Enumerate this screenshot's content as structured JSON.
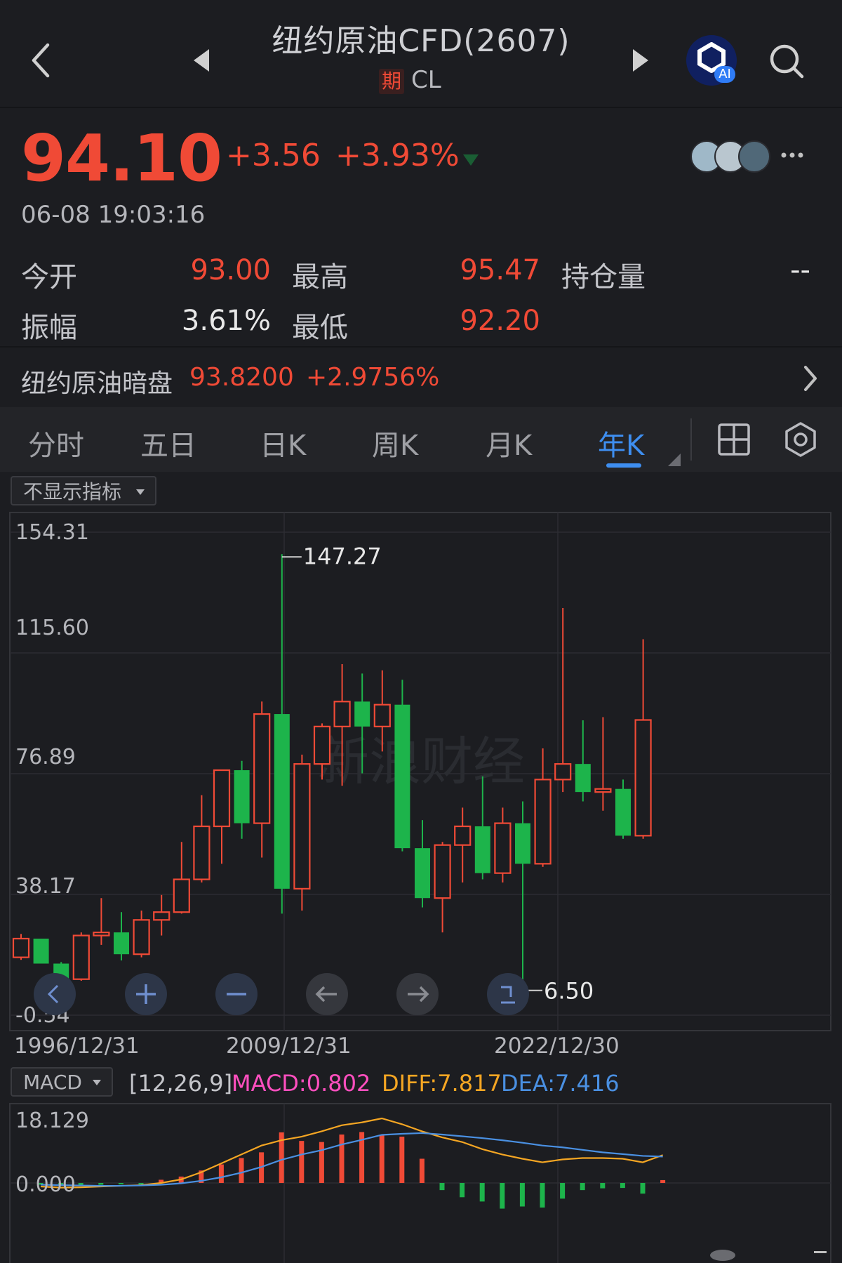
{
  "header": {
    "title": "纽约原油CFD(2607)",
    "badge": "期",
    "code": "CL",
    "ai_badge": "AI"
  },
  "quote": {
    "price": "94.10",
    "change": "+3.56",
    "change_pct": "+3.93%",
    "datetime": "06-08 19:03:16",
    "stats": {
      "open_label": "今开",
      "open": "93.00",
      "high_label": "最高",
      "high": "95.47",
      "oi_label": "持仓量",
      "oi": "--",
      "amp_label": "振幅",
      "amp": "3.61%",
      "low_label": "最低",
      "low": "92.20"
    },
    "dark": {
      "label": "纽约原油暗盘",
      "price": "93.8200",
      "pct": "+2.9756%"
    }
  },
  "tabs": [
    {
      "label": "分时"
    },
    {
      "label": "五日"
    },
    {
      "label": "日K"
    },
    {
      "label": "周K"
    },
    {
      "label": "月K"
    },
    {
      "label": "年K"
    }
  ],
  "indicator": {
    "label": "不显示指标"
  },
  "watermark": "新浪财经",
  "colors": {
    "up": "#f04a36",
    "down": "#1db44b",
    "accent": "#3e8ef0",
    "macd": "#ff4fbf",
    "diff": "#f5a623",
    "dea": "#4a90e2"
  },
  "chart_data": [
    {
      "type": "candlestick",
      "period": "yearly",
      "y_ticks": [
        "154.31",
        "115.60",
        "76.89",
        "38.17",
        "-0.54"
      ],
      "ylim": [
        -0.54,
        154.31
      ],
      "x_labels": [
        "1996/12/31",
        "2009/12/31",
        "2022/12/30"
      ],
      "max_label": "147.27",
      "min_label": "6.50",
      "candles": [
        {
          "o": 18.0,
          "h": 25.5,
          "l": 17.2,
          "c": 24.0
        },
        {
          "o": 24.0,
          "h": 24.0,
          "l": 16.0,
          "c": 16.0
        },
        {
          "o": 16.0,
          "h": 16.5,
          "l": 10.5,
          "c": 11.0
        },
        {
          "o": 11.0,
          "h": 26.0,
          "l": 10.5,
          "c": 25.0
        },
        {
          "o": 25.0,
          "h": 37.0,
          "l": 22.0,
          "c": 26.0
        },
        {
          "o": 26.0,
          "h": 32.5,
          "l": 17.0,
          "c": 19.0
        },
        {
          "o": 19.0,
          "h": 33.0,
          "l": 18.0,
          "c": 30.0
        },
        {
          "o": 30.0,
          "h": 38.0,
          "l": 25.0,
          "c": 32.5
        },
        {
          "o": 32.5,
          "h": 55.0,
          "l": 32.0,
          "c": 43.0
        },
        {
          "o": 43.0,
          "h": 70.0,
          "l": 42.0,
          "c": 60.0
        },
        {
          "o": 60.0,
          "h": 78.0,
          "l": 48.0,
          "c": 78.0
        },
        {
          "o": 78.0,
          "h": 81.0,
          "l": 56.0,
          "c": 61.0
        },
        {
          "o": 61.0,
          "h": 100.0,
          "l": 50.0,
          "c": 96.0
        },
        {
          "o": 96.0,
          "h": 147.27,
          "l": 32.0,
          "c": 40.0
        },
        {
          "o": 40.0,
          "h": 83.0,
          "l": 33.0,
          "c": 80.0
        },
        {
          "o": 80.0,
          "h": 93.0,
          "l": 75.0,
          "c": 92.0
        },
        {
          "o": 92.0,
          "h": 112.0,
          "l": 73.0,
          "c": 100.0
        },
        {
          "o": 100.0,
          "h": 109.0,
          "l": 77.0,
          "c": 92.0
        },
        {
          "o": 92.0,
          "h": 110.0,
          "l": 84.0,
          "c": 99.0
        },
        {
          "o": 99.0,
          "h": 107.0,
          "l": 52.0,
          "c": 53.0
        },
        {
          "o": 53.0,
          "h": 62.0,
          "l": 34.0,
          "c": 37.0
        },
        {
          "o": 37.0,
          "h": 55.0,
          "l": 26.0,
          "c": 54.0
        },
        {
          "o": 54.0,
          "h": 66.0,
          "l": 42.0,
          "c": 60.0
        },
        {
          "o": 60.0,
          "h": 76.0,
          "l": 43.0,
          "c": 45.0
        },
        {
          "o": 45.0,
          "h": 66.0,
          "l": 42.0,
          "c": 61.0
        },
        {
          "o": 61.0,
          "h": 68.0,
          "l": 6.5,
          "c": 48.0
        },
        {
          "o": 48.0,
          "h": 85.0,
          "l": 47.0,
          "c": 75.0
        },
        {
          "o": 75.0,
          "h": 130.0,
          "l": 71.0,
          "c": 80.0
        },
        {
          "o": 80.0,
          "h": 94.0,
          "l": 68.0,
          "c": 71.0
        },
        {
          "o": 71.0,
          "h": 95.0,
          "l": 65.0,
          "c": 72.0
        },
        {
          "o": 72.0,
          "h": 75.0,
          "l": 56.0,
          "c": 57.0
        },
        {
          "o": 57.0,
          "h": 120.0,
          "l": 56.0,
          "c": 94.1
        }
      ]
    },
    {
      "type": "bar",
      "name": "MACD",
      "params": "[12,26,9]",
      "macd_text": "MACD:0.802",
      "diff_text": "DIFF:7.817",
      "dea_text": "DEA:7.416",
      "y_ticks": [
        "18.129",
        "0.000"
      ],
      "ylim": [
        -8.0,
        18.129
      ],
      "series": [
        {
          "name": "MACD",
          "values": [
            -0.5,
            -0.8,
            -0.6,
            -0.5,
            -0.3,
            -0.2,
            0.9,
            1.8,
            3.5,
            5.2,
            7.0,
            8.6,
            14.2,
            11.8,
            11.5,
            13.6,
            14.3,
            13.5,
            13.0,
            6.8,
            -2.0,
            -4.0,
            -5.2,
            -7.2,
            -6.6,
            -6.9,
            -4.4,
            -2.0,
            -1.5,
            -1.4,
            -3.0,
            0.8
          ]
        },
        {
          "name": "DIFF",
          "values": [
            -1.0,
            -1.3,
            -1.2,
            -1.0,
            -0.8,
            -0.6,
            0.0,
            1.0,
            3.0,
            5.5,
            8.0,
            10.5,
            12.0,
            13.0,
            14.5,
            16.2,
            17.0,
            18.129,
            16.5,
            14.5,
            12.8,
            11.5,
            9.5,
            8.0,
            6.8,
            5.8,
            6.6,
            7.0,
            7.0,
            6.8,
            5.8,
            7.817
          ]
        },
        {
          "name": "DEA",
          "values": [
            -0.5,
            -0.6,
            -0.7,
            -0.8,
            -0.8,
            -0.7,
            -0.5,
            -0.1,
            0.6,
            1.6,
            2.9,
            4.5,
            6.5,
            8.0,
            9.2,
            10.8,
            12.1,
            13.5,
            13.8,
            14.0,
            13.6,
            13.1,
            12.6,
            12.0,
            11.3,
            10.5,
            10.0,
            9.3,
            8.6,
            8.1,
            7.6,
            7.416
          ]
        }
      ]
    }
  ]
}
